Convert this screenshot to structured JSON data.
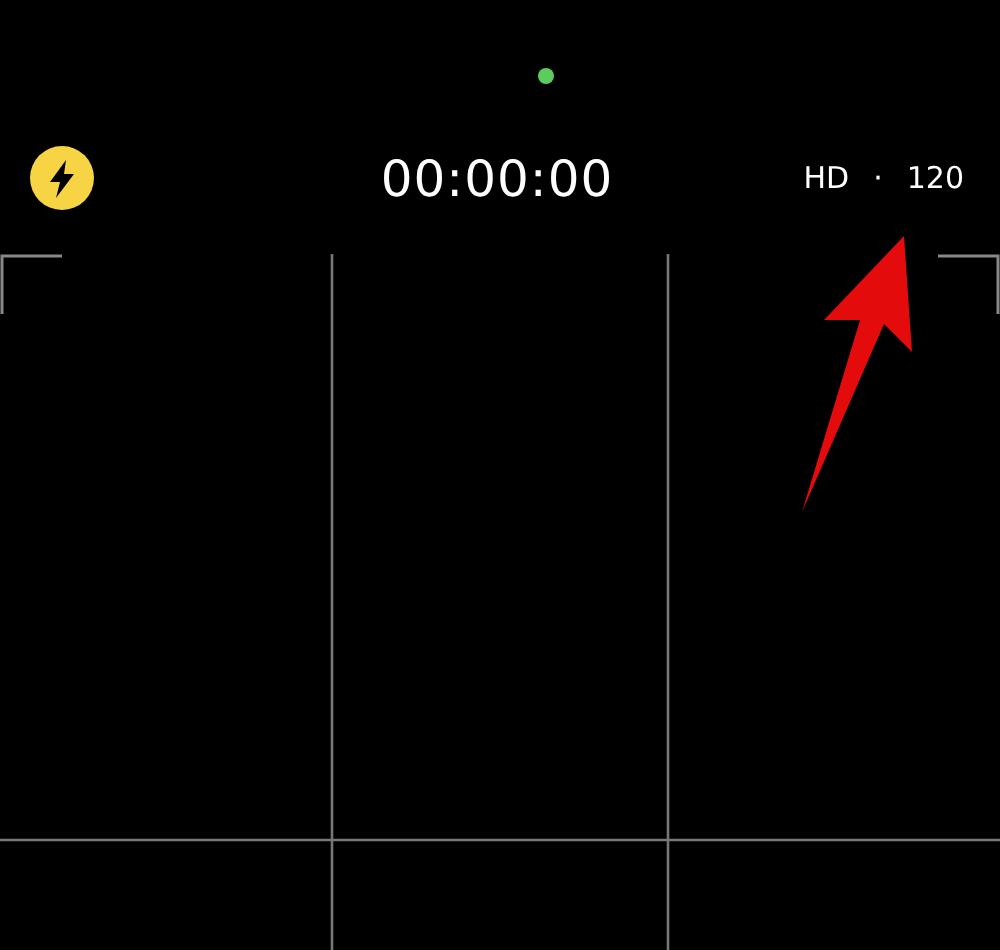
{
  "camera_indicator": {
    "on": true
  },
  "flash": {
    "on": true
  },
  "timer": "00:00:00",
  "format": {
    "resolution": "HD",
    "separator": "·",
    "frame_rate": "120"
  }
}
